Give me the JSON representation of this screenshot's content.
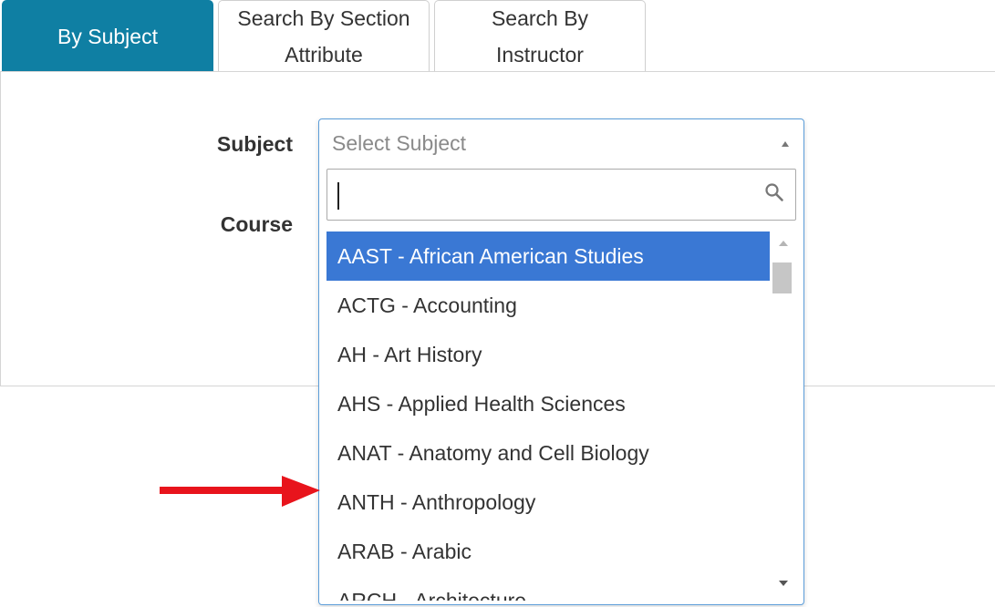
{
  "tabs": [
    {
      "label": "By Subject",
      "active": true
    },
    {
      "label_line1": "Search By Section",
      "label_line2": "Attribute"
    },
    {
      "label_line1": "Search By",
      "label_line2": "Instructor"
    }
  ],
  "form": {
    "subject_label": "Subject",
    "course_label": "Course"
  },
  "subject_select": {
    "placeholder": "Select Subject",
    "search_value": "",
    "options": [
      "AAST - African American Studies",
      "ACTG - Accounting",
      "AH - Art History",
      "AHS - Applied Health Sciences",
      "ANAT - Anatomy and Cell Biology",
      "ANTH - Anthropology",
      "ARAB - Arabic",
      "ARCH - Architecture"
    ],
    "highlighted_index": 0
  },
  "colors": {
    "active_tab": "#0f7fa3",
    "highlight": "#3a78d4",
    "focus_border": "#5b9dd9",
    "annotation_arrow": "#e8141c"
  },
  "icons": {
    "search": "search-icon",
    "dropdown": "caret-up-icon",
    "annotation": "red-arrow-icon"
  }
}
